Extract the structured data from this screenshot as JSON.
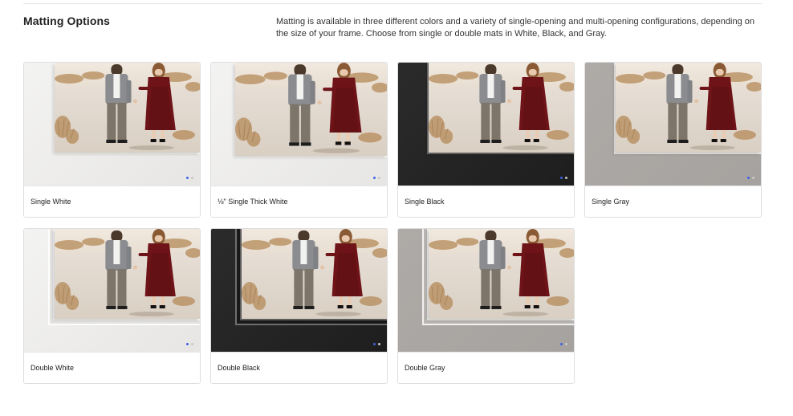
{
  "section": {
    "title": "Matting Options",
    "description": "Matting is available in three different colors and a variety of single-opening and multi-opening configurations, depending on the size of your frame. Choose from single or double mats in White, Black, and Gray."
  },
  "options": [
    {
      "label": "Single White",
      "mat": "white",
      "style": "single"
    },
    {
      "label": "⅛\" Single Thick White",
      "mat": "white",
      "style": "thick"
    },
    {
      "label": "Single Black",
      "mat": "black",
      "style": "single"
    },
    {
      "label": "Single Gray",
      "mat": "gray",
      "style": "single"
    },
    {
      "label": "Double White",
      "mat": "white",
      "style": "double"
    },
    {
      "label": "Double Black",
      "mat": "black",
      "style": "double"
    },
    {
      "label": "Double Gray",
      "mat": "gray",
      "style": "double"
    }
  ],
  "carousel": {
    "active_slide": 1,
    "slide_count": 2
  },
  "colors": {
    "mat_white": "#eeedeb",
    "mat_black": "#222222",
    "mat_gray": "#a9a5a2",
    "dot_active": "#3b63e6",
    "dot_inactive": "#c9c9c9"
  },
  "icons": {
    "image": "framed-couple-photo",
    "carousel": "carousel-dot-icon"
  }
}
